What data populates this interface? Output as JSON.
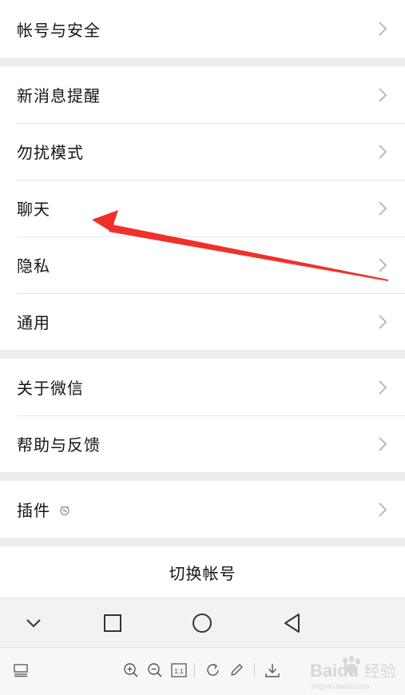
{
  "settings": {
    "group1": [
      {
        "label": "帐号与安全"
      }
    ],
    "group2": [
      {
        "label": "新消息提醒"
      },
      {
        "label": "勿扰模式"
      },
      {
        "label": "聊天"
      },
      {
        "label": "隐私"
      },
      {
        "label": "通用"
      }
    ],
    "group3": [
      {
        "label": "关于微信"
      },
      {
        "label": "帮助与反馈"
      }
    ],
    "group4": [
      {
        "label": "插件"
      }
    ],
    "switch_account": "切换帐号"
  },
  "navbar": {
    "icons": [
      "chevron-down-icon",
      "square-recent-icon",
      "circle-home-icon",
      "triangle-back-icon"
    ]
  },
  "toolbar": {
    "actual_size_label": "1:1",
    "icons": [
      "thumbnail-icon",
      "zoom-in-icon",
      "zoom-out-icon",
      "actual-size-icon",
      "rotate-icon",
      "edit-icon",
      "download-icon"
    ]
  },
  "watermark": {
    "brand": "Baidu",
    "text": "经验",
    "url": "jingyan.baidu.com"
  },
  "colors": {
    "background": "#ededed",
    "row": "#ffffff",
    "chevron": "#b2b2b2",
    "arrow": "#f0302a",
    "navbar": "#f2f2f2"
  }
}
